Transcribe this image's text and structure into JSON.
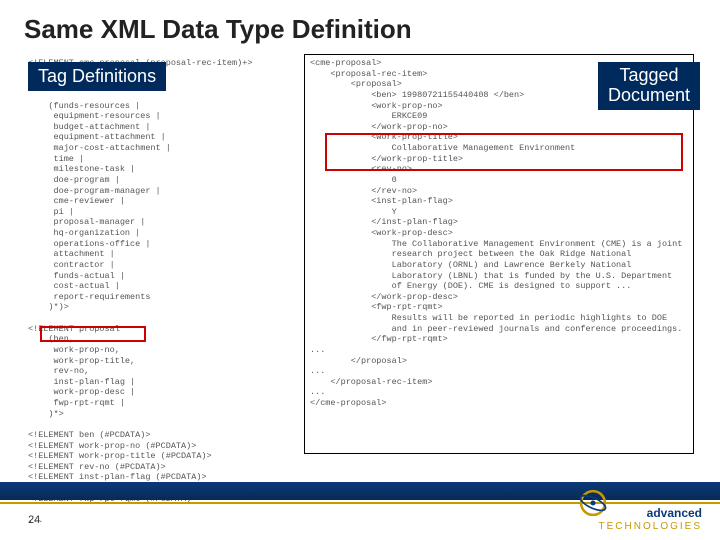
{
  "title": "Same XML Data Type Definition",
  "labels": {
    "left": "Tag Definitions",
    "right": "Tagged\nDocument"
  },
  "page_number": "24",
  "logo": {
    "line1": "advanced",
    "line2": "TECHNOLOGIES"
  },
  "code_left": "<!ELEMENT cme-proposal (proposal-rec-item)+>\n\n\n\n    (funds-resources |\n     equipment-resources |\n     budget-attachment |\n     equipment-attachment |\n     major-cost-attachment |\n     time |\n     milestone-task |\n     doe-program |\n     doe-program-manager |\n     cme-reviewer |\n     pi |\n     proposal-manager |\n     hq-organization |\n     operations-office |\n     attachment |\n     contractor |\n     funds-actual |\n     cost-actual |\n     report-requirements\n    )*)>\n\n<!ELEMENT proposal\n    (ben,\n     work-prop-no,\n     work-prop-title,\n     rev-no,\n     inst-plan-flag |\n     work-prop-desc |\n     fwp-rpt-rqmt |\n    )*>\n\n<!ELEMENT ben (#PCDATA)>\n<!ELEMENT work-prop-no (#PCDATA)>\n<!ELEMENT work-prop-title (#PCDATA)>\n<!ELEMENT rev-no (#PCDATA)>\n<!ELEMENT inst-plan-flag (#PCDATA)>\n<!ELEMENT work-prop-desc (#PCDATA)>\n<!ELEMENT fwp-rpt-rqmt (#PCDATA)>\n\n...",
  "code_right": "<cme-proposal>\n    <proposal-rec-item>\n        <proposal>\n            <ben> 19980721155440408 </ben>\n            <work-prop-no>\n                ERKCE09\n            </work-prop-no>\n            <work-prop-title>\n                Collaborative Management Environment\n            </work-prop-title>\n            <rev-no>\n                0\n            </rev-no>\n            <inst-plan-flag>\n                Y\n            </inst-plan-flag>\n            <work-prop-desc>\n                The Collaborative Management Environment (CME) is a joint\n                research project between the Oak Ridge National\n                Laboratory (ORNL) and Lawrence Berkely National\n                Laboratory (LBNL) that is funded by the U.S. Department\n                of Energy (DOE). CME is designed to support ...\n            </work-prop-desc>\n            <fwp-rpt-rqmt>\n                Results will be reported in periodic highlights to DOE\n                and in peer-reviewed journals and conference proceedings.\n            </fwp-rpt-rqmt>\n...\n        </proposal>\n...\n    </proposal-rec-item>\n...\n</cme-proposal>"
}
